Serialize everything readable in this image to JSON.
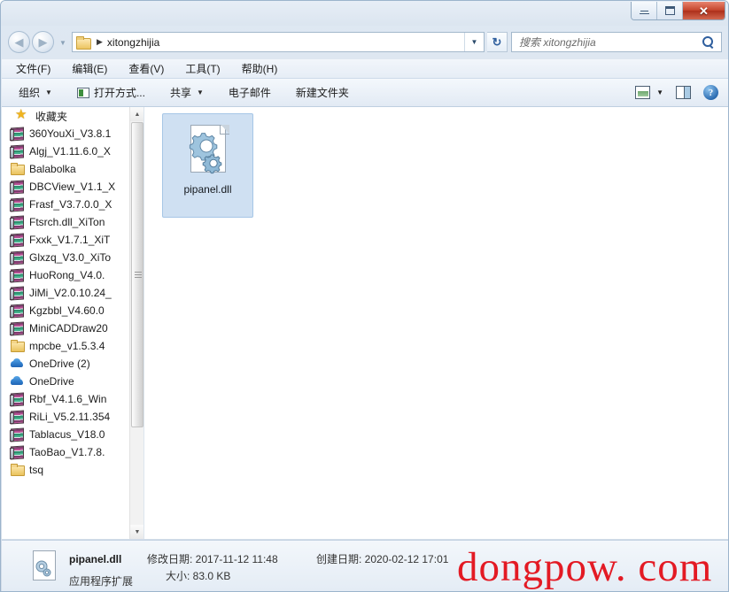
{
  "window": {
    "controls": {
      "minimize_label": "–",
      "maximize_label": "□",
      "close_label": "✕"
    }
  },
  "addressbar": {
    "back_label": "◀",
    "forward_label": "▶",
    "history_label": "▼",
    "folder_icon": "folder-icon",
    "crumb_separator": "▶",
    "path": "xitongzhijia",
    "dropdown_label": "▼",
    "refresh_label": "↻"
  },
  "search": {
    "placeholder": "搜索 xitongzhijia",
    "value": ""
  },
  "menu": {
    "items": [
      {
        "label": "文件(F)"
      },
      {
        "label": "编辑(E)"
      },
      {
        "label": "查看(V)"
      },
      {
        "label": "工具(T)"
      },
      {
        "label": "帮助(H)"
      }
    ]
  },
  "toolbar": {
    "organize_label": "组织",
    "organize_caret": "▼",
    "openwith_label": "打开方式...",
    "share_label": "共享",
    "share_caret": "▼",
    "email_label": "电子邮件",
    "newfolder_label": "新建文件夹",
    "view_caret": "▼",
    "help_label": "?"
  },
  "sidebar": {
    "header": {
      "label": "收藏夹",
      "icon": "star-icon"
    },
    "items": [
      {
        "label": "360YouXi_V3.8.1",
        "icon": "archive-icon"
      },
      {
        "label": "Algj_V1.11.6.0_X",
        "icon": "archive-icon"
      },
      {
        "label": "Balabolka",
        "icon": "folder-icon"
      },
      {
        "label": "DBCView_V1.1_X",
        "icon": "archive-icon"
      },
      {
        "label": "Frasf_V3.7.0.0_X",
        "icon": "archive-icon"
      },
      {
        "label": "Ftsrch.dll_XiTon",
        "icon": "archive-icon"
      },
      {
        "label": "Fxxk_V1.7.1_XiT",
        "icon": "archive-icon"
      },
      {
        "label": "Glxzq_V3.0_XiTo",
        "icon": "archive-icon"
      },
      {
        "label": "HuoRong_V4.0.",
        "icon": "archive-icon"
      },
      {
        "label": "JiMi_V2.0.10.24_",
        "icon": "archive-icon"
      },
      {
        "label": "Kgzbbl_V4.60.0",
        "icon": "archive-icon"
      },
      {
        "label": "MiniCADDraw20",
        "icon": "archive-icon"
      },
      {
        "label": "mpcbe_v1.5.3.4",
        "icon": "folder-icon"
      },
      {
        "label": "OneDrive (2)",
        "icon": "cloud-icon"
      },
      {
        "label": "OneDrive",
        "icon": "cloud-icon"
      },
      {
        "label": "Rbf_V4.1.6_Win",
        "icon": "archive-icon"
      },
      {
        "label": "RiLi_V5.2.11.354",
        "icon": "archive-icon"
      },
      {
        "label": "Tablacus_V18.0",
        "icon": "archive-icon"
      },
      {
        "label": "TaoBao_V1.7.8.",
        "icon": "archive-icon"
      },
      {
        "label": "tsq",
        "icon": "folder-icon"
      }
    ],
    "scroll": {
      "up_label": "▲",
      "down_label": "▼"
    }
  },
  "filepane": {
    "files": [
      {
        "name": "pipanel.dll",
        "icon": "dll-icon",
        "selected": true
      }
    ]
  },
  "statusbar": {
    "file_name": "pipanel.dll",
    "file_type": "应用程序扩展",
    "modified_label": "修改日期: 2017-11-12 11:48",
    "size_label": "大小: 83.0 KB",
    "created_label": "创建日期: 2020-02-12 17:01"
  },
  "watermark": {
    "text": "dongpow. com",
    "color": "#e31a24"
  }
}
